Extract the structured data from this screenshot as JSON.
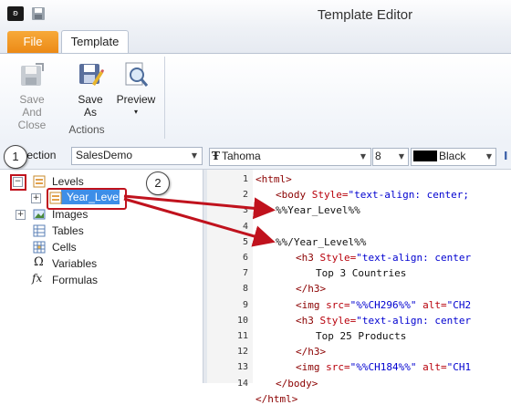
{
  "window": {
    "title": "Template Editor"
  },
  "tabs": [
    {
      "label": "File"
    },
    {
      "label": "Template"
    }
  ],
  "ribbon": {
    "buttons": [
      {
        "label_line1": "Save And",
        "label_line2": "Close",
        "icon": "save-and-close-icon",
        "enabled": false
      },
      {
        "label_line1": "Save",
        "label_line2": "As",
        "icon": "save-as-icon",
        "enabled": true
      },
      {
        "label_line1": "Preview",
        "label_line2": "▾",
        "icon": "preview-icon",
        "enabled": true
      }
    ],
    "group_label": "Actions"
  },
  "toolbar": {
    "connection_label": "nnection",
    "connection_value": "SalesDemo",
    "font_value": "Tahoma",
    "size_value": "8",
    "color_value": "Black",
    "font_icon": "Ŧ"
  },
  "tree": {
    "items": [
      {
        "label": "Levels",
        "icon": "levels-icon"
      },
      {
        "label": "Year_Level",
        "icon": "level-item-icon",
        "selected": true
      },
      {
        "label": "Images",
        "icon": "images-icon"
      },
      {
        "label": "Tables",
        "icon": "tables-icon"
      },
      {
        "label": "Cells",
        "icon": "cells-icon"
      },
      {
        "label": "Variables",
        "icon": "omega-icon",
        "glyph": "Ω"
      },
      {
        "label": "Formulas",
        "icon": "fx-icon",
        "glyph": "fx"
      }
    ]
  },
  "callouts": [
    "1",
    "2"
  ],
  "editor": {
    "line_numbers": [
      "1",
      "2",
      "3",
      "4",
      "5",
      "6",
      "7",
      "8",
      "9",
      "10",
      "11",
      "12",
      "13",
      "14"
    ],
    "lines": [
      {
        "tag": "<html>",
        "rest": ""
      },
      {
        "tag": "<body",
        "attr": " Style=",
        "str": "\"text-align: center;"
      },
      {
        "txt": "%%Year_Level%%"
      },
      {
        "txt": ""
      },
      {
        "txt": "%%/Year_Level%%"
      },
      {
        "tag": "<h3",
        "attr": " Style=",
        "str": "\"text-align: center"
      },
      {
        "txt": "Top 3 Countries"
      },
      {
        "tag": "</h3>"
      },
      {
        "tag": "<img",
        "attr": " src=",
        "str": "\"%%CH296%%\"",
        "attr2": " alt=",
        "str2": "\"CH2"
      },
      {
        "tag": "<h3",
        "attr": " Style=",
        "str": "\"text-align: center"
      },
      {
        "txt": "Top 25 Products"
      },
      {
        "tag": "</h3>"
      },
      {
        "tag": "<img",
        "attr": " src=",
        "str": "\"%%CH184%%\"",
        "attr2": " alt=",
        "str2": "\"CH1"
      },
      {
        "tag": "</body>"
      }
    ],
    "partial_last": "</html>"
  }
}
